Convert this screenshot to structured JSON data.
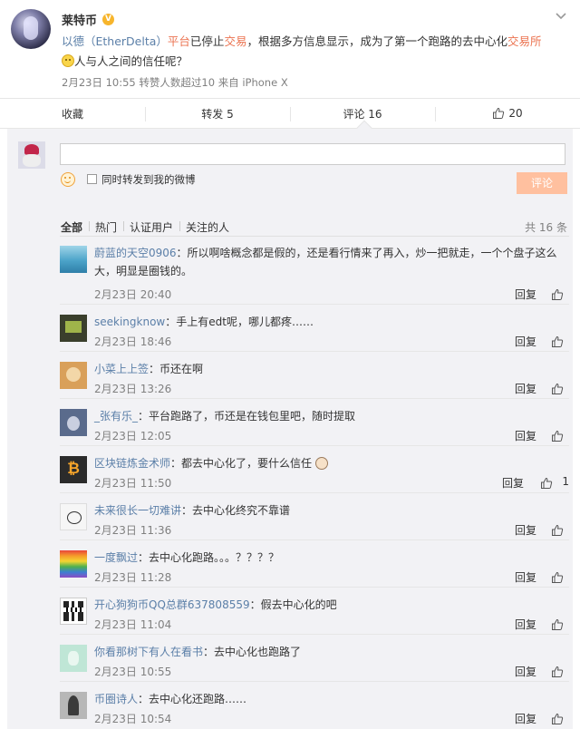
{
  "post": {
    "author": "莱特币",
    "text_part1": "以德（EtherDelta）",
    "text_part2": "平台",
    "text_part3": "已停止",
    "text_part4": "交易",
    "text_part5": "，根据多方信息显示，成为了第一个跑路的去中心化",
    "text_part6": "交易所",
    "text_line2": "人与人之间的信任呢？",
    "meta": "2月23日 10:55 转赞人数超过10 来自 iPhone X"
  },
  "actions": {
    "favorite": "收藏",
    "repost": "转发 5",
    "comment": "评论 16",
    "like": "20"
  },
  "composer": {
    "input_value": "",
    "input_placeholder": "",
    "repost_label": "同时转发到我的微博",
    "submit_label": "评论"
  },
  "tabs": [
    "全部",
    "热门",
    "认证用户",
    "关注的人"
  ],
  "total_count": "共 16 条",
  "reply_label": "回复",
  "comments": [
    {
      "user": "蔚蓝的天空0906",
      "text": "：所以啊啥概念都是假的，还是看行情来了再入，炒一把就走，一个个盘子这么大，明显是圈钱的。",
      "time": "2月23日 20:40",
      "like_count": ""
    },
    {
      "user": "seekingknow",
      "text": "：手上有edt呢，哪儿都疼……",
      "time": "2月23日 18:46",
      "like_count": ""
    },
    {
      "user": "小菜上上签",
      "text": "：币还在啊",
      "time": "2月23日 13:26",
      "like_count": ""
    },
    {
      "user": "_张有乐_",
      "text": "：平台跑路了，币还是在钱包里吧，随时提取",
      "time": "2月23日 12:05",
      "like_count": ""
    },
    {
      "user": "区块链炼金术师",
      "text": "：都去中心化了，要什么信任",
      "time": "2月23日 11:50",
      "like_count": "1"
    },
    {
      "user": "未来很长一切难讲",
      "text": "：去中心化终究不靠谱",
      "time": "2月23日 11:36",
      "like_count": ""
    },
    {
      "user": "一度飘过",
      "text": "：去中心化跑路。。。？？？？",
      "time": "2月23日 11:28",
      "like_count": ""
    },
    {
      "user": "开心狗狗币QQ总群637808559",
      "text": "：假去中心化的吧",
      "time": "2月23日 11:04",
      "like_count": ""
    },
    {
      "user": "你看那树下有人在看书",
      "text": "：去中心化也跑路了",
      "time": "2月23日 10:55",
      "like_count": ""
    },
    {
      "user": "币圈诗人",
      "text": "：去中心化还跑路……",
      "time": "2月23日 10:54",
      "like_count": ""
    }
  ]
}
